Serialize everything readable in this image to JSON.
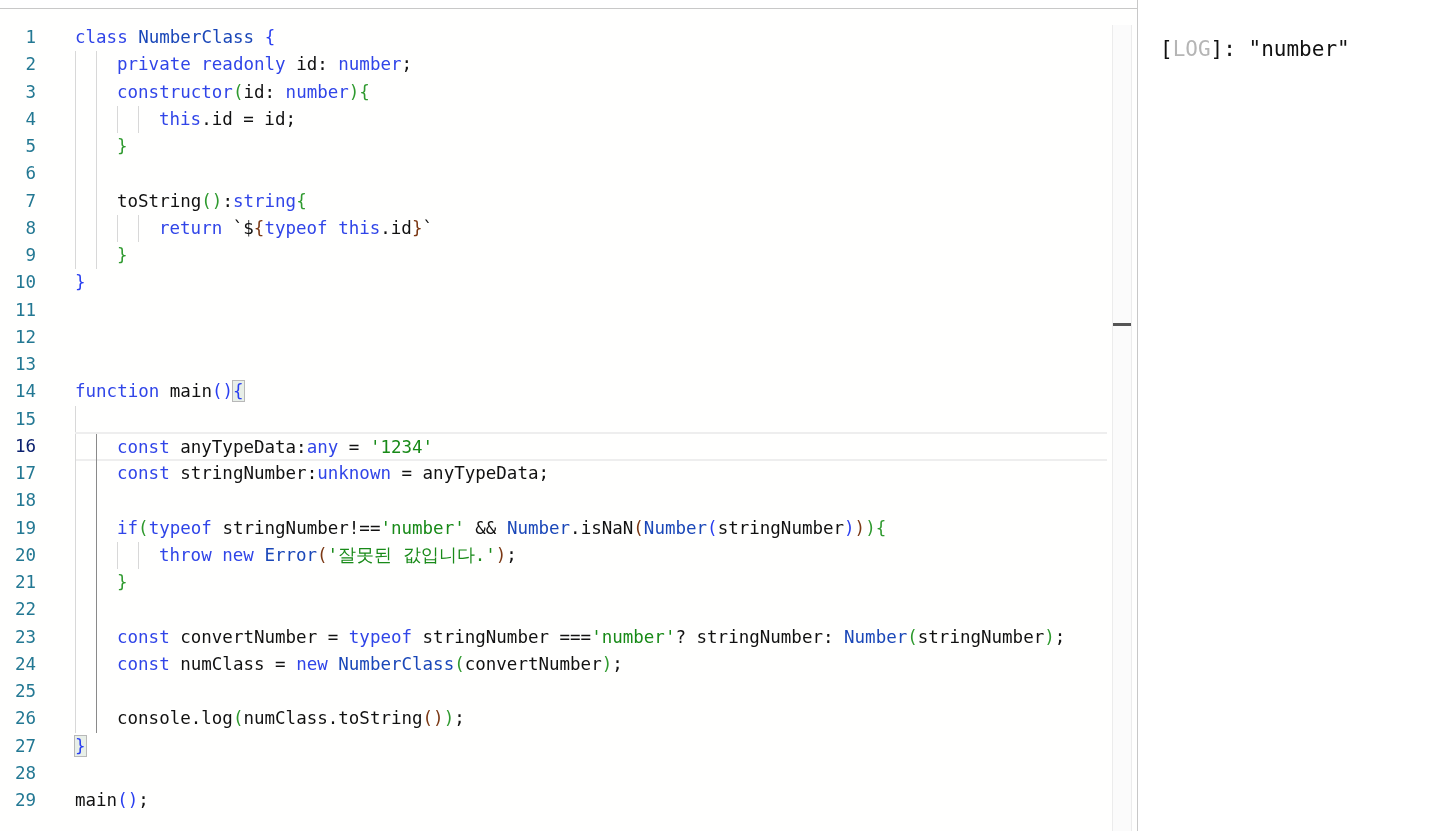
{
  "editor": {
    "lines": [
      {
        "number": "1",
        "current": false,
        "tokens": [
          {
            "kind": "kw",
            "text": "class"
          },
          {
            "kind": "cls",
            "text": " NumberClass"
          },
          {
            "kind": "b1",
            "text": " {"
          }
        ]
      },
      {
        "number": "2",
        "current": false,
        "guides": [
          {
            "active": false
          },
          {
            "active": false
          }
        ],
        "tokens": [
          {
            "kind": "kw",
            "text": "private"
          },
          {
            "kind": "kw",
            "text": " readonly"
          },
          {
            "kind": "plain",
            "text": " id: "
          },
          {
            "kind": "kw",
            "text": "number"
          },
          {
            "kind": "plain",
            "text": ";"
          }
        ]
      },
      {
        "number": "3",
        "current": false,
        "guides": [
          {
            "active": false
          },
          {
            "active": false
          }
        ],
        "tokens": [
          {
            "kind": "kw",
            "text": "constructor"
          },
          {
            "kind": "b2",
            "text": "("
          },
          {
            "kind": "plain",
            "text": "id: "
          },
          {
            "kind": "kw",
            "text": "number"
          },
          {
            "kind": "b2",
            "text": "){"
          }
        ]
      },
      {
        "number": "4",
        "current": false,
        "guides": [
          {
            "active": false
          },
          {
            "active": false
          },
          {
            "active": false
          },
          {
            "active": false
          }
        ],
        "tokens": [
          {
            "kind": "kw",
            "text": "this"
          },
          {
            "kind": "plain",
            "text": ".id = id;"
          }
        ]
      },
      {
        "number": "5",
        "current": false,
        "guides": [
          {
            "active": false
          },
          {
            "active": false
          }
        ],
        "tokens": [
          {
            "kind": "b2",
            "text": "}"
          }
        ]
      },
      {
        "number": "6",
        "current": false,
        "guides": [
          {
            "active": false
          },
          {
            "active": false
          }
        ]
      },
      {
        "number": "7",
        "current": false,
        "guides": [
          {
            "active": false
          },
          {
            "active": false
          }
        ],
        "tokens": [
          {
            "kind": "plain",
            "text": "toString"
          },
          {
            "kind": "b2",
            "text": "()"
          },
          {
            "kind": "plain",
            "text": ":"
          },
          {
            "kind": "kw",
            "text": "string"
          },
          {
            "kind": "b2",
            "text": "{"
          }
        ]
      },
      {
        "number": "8",
        "current": false,
        "guides": [
          {
            "active": false
          },
          {
            "active": false
          },
          {
            "active": false
          },
          {
            "active": false
          }
        ],
        "tokens": [
          {
            "kind": "kw",
            "text": "return"
          },
          {
            "kind": "plain",
            "text": " `$"
          },
          {
            "kind": "b3",
            "text": "{"
          },
          {
            "kind": "kw",
            "text": "typeof"
          },
          {
            "kind": "kw",
            "text": " this"
          },
          {
            "kind": "plain",
            "text": ".id"
          },
          {
            "kind": "b3",
            "text": "}"
          },
          {
            "kind": "plain",
            "text": "`"
          }
        ]
      },
      {
        "number": "9",
        "current": false,
        "guides": [
          {
            "active": false
          },
          {
            "active": false
          }
        ],
        "tokens": [
          {
            "kind": "b2",
            "text": "}"
          }
        ]
      },
      {
        "number": "10",
        "current": false,
        "tokens": [
          {
            "kind": "b1",
            "text": "}"
          }
        ]
      },
      {
        "number": "11",
        "current": false
      },
      {
        "number": "12",
        "current": false
      },
      {
        "number": "13",
        "current": false
      },
      {
        "number": "14",
        "current": false,
        "tokens": [
          {
            "kind": "kw",
            "text": "function"
          },
          {
            "kind": "plain",
            "text": " main"
          },
          {
            "kind": "b1",
            "text": "()"
          },
          {
            "kind": "match",
            "text": "{"
          }
        ]
      },
      {
        "number": "15",
        "current": false,
        "guides": [
          {
            "active": false
          }
        ]
      },
      {
        "number": "16",
        "current": true,
        "guides": [
          {
            "active": false
          },
          {
            "active": true
          }
        ],
        "tokens": [
          {
            "kind": "kw",
            "text": "const"
          },
          {
            "kind": "plain",
            "text": " anyTypeData:"
          },
          {
            "kind": "kw",
            "text": "any"
          },
          {
            "kind": "plain",
            "text": " = "
          },
          {
            "kind": "str",
            "text": "'1234'"
          }
        ]
      },
      {
        "number": "17",
        "current": false,
        "guides": [
          {
            "active": false
          },
          {
            "active": true
          }
        ],
        "tokens": [
          {
            "kind": "kw",
            "text": "const"
          },
          {
            "kind": "plain",
            "text": " stringNumber:"
          },
          {
            "kind": "kw",
            "text": "unknown"
          },
          {
            "kind": "plain",
            "text": " = anyTypeData;"
          }
        ]
      },
      {
        "number": "18",
        "current": false,
        "guides": [
          {
            "active": false
          },
          {
            "active": true
          }
        ]
      },
      {
        "number": "19",
        "current": false,
        "guides": [
          {
            "active": false
          },
          {
            "active": true
          }
        ],
        "tokens": [
          {
            "kind": "kw",
            "text": "if"
          },
          {
            "kind": "b2",
            "text": "("
          },
          {
            "kind": "kw",
            "text": "typeof"
          },
          {
            "kind": "plain",
            "text": " stringNumber!=="
          },
          {
            "kind": "str",
            "text": "'number'"
          },
          {
            "kind": "plain",
            "text": " && "
          },
          {
            "kind": "cls",
            "text": "Number"
          },
          {
            "kind": "plain",
            "text": ".isNaN"
          },
          {
            "kind": "b3",
            "text": "("
          },
          {
            "kind": "cls",
            "text": "Number"
          },
          {
            "kind": "b1",
            "text": "("
          },
          {
            "kind": "plain",
            "text": "stringNumber"
          },
          {
            "kind": "b1",
            "text": ")"
          },
          {
            "kind": "b3",
            "text": ")"
          },
          {
            "kind": "b2",
            "text": "){"
          }
        ]
      },
      {
        "number": "20",
        "current": false,
        "guides": [
          {
            "active": false
          },
          {
            "active": true
          },
          {
            "active": false
          },
          {
            "active": false
          }
        ],
        "tokens": [
          {
            "kind": "kw",
            "text": "throw"
          },
          {
            "kind": "kw",
            "text": " new"
          },
          {
            "kind": "cls",
            "text": " Error"
          },
          {
            "kind": "b3",
            "text": "("
          },
          {
            "kind": "str",
            "text": "'잘못된 값입니다.'"
          },
          {
            "kind": "b3",
            "text": ")"
          },
          {
            "kind": "plain",
            "text": ";"
          }
        ]
      },
      {
        "number": "21",
        "current": false,
        "guides": [
          {
            "active": false
          },
          {
            "active": true
          }
        ],
        "tokens": [
          {
            "kind": "b2",
            "text": "}"
          }
        ]
      },
      {
        "number": "22",
        "current": false,
        "guides": [
          {
            "active": false
          },
          {
            "active": true
          }
        ]
      },
      {
        "number": "23",
        "current": false,
        "guides": [
          {
            "active": false
          },
          {
            "active": true
          }
        ],
        "tokens": [
          {
            "kind": "kw",
            "text": "const"
          },
          {
            "kind": "plain",
            "text": " convertNumber = "
          },
          {
            "kind": "kw",
            "text": "typeof"
          },
          {
            "kind": "plain",
            "text": " stringNumber ==="
          },
          {
            "kind": "str",
            "text": "'number'"
          },
          {
            "kind": "plain",
            "text": "? stringNumber: "
          },
          {
            "kind": "cls",
            "text": "Number"
          },
          {
            "kind": "b2",
            "text": "("
          },
          {
            "kind": "plain",
            "text": "stringNumber"
          },
          {
            "kind": "b2",
            "text": ")"
          },
          {
            "kind": "plain",
            "text": ";"
          }
        ]
      },
      {
        "number": "24",
        "current": false,
        "guides": [
          {
            "active": false
          },
          {
            "active": true
          }
        ],
        "tokens": [
          {
            "kind": "kw",
            "text": "const"
          },
          {
            "kind": "plain",
            "text": " numClass = "
          },
          {
            "kind": "kw",
            "text": "new"
          },
          {
            "kind": "cls",
            "text": " NumberClass"
          },
          {
            "kind": "b2",
            "text": "("
          },
          {
            "kind": "plain",
            "text": "convertNumber"
          },
          {
            "kind": "b2",
            "text": ")"
          },
          {
            "kind": "plain",
            "text": ";"
          }
        ]
      },
      {
        "number": "25",
        "current": false,
        "guides": [
          {
            "active": false
          },
          {
            "active": true
          }
        ]
      },
      {
        "number": "26",
        "current": false,
        "guides": [
          {
            "active": false
          },
          {
            "active": true
          }
        ],
        "tokens": [
          {
            "kind": "plain",
            "text": "console.log"
          },
          {
            "kind": "b2",
            "text": "("
          },
          {
            "kind": "plain",
            "text": "numClass.toString"
          },
          {
            "kind": "b3",
            "text": "()"
          },
          {
            "kind": "b2",
            "text": ")"
          },
          {
            "kind": "plain",
            "text": ";"
          }
        ]
      },
      {
        "number": "27",
        "current": false,
        "tokens": [
          {
            "kind": "match",
            "text": "}"
          }
        ]
      },
      {
        "number": "28",
        "current": false
      },
      {
        "number": "29",
        "current": false,
        "tokens": [
          {
            "kind": "plain",
            "text": "main"
          },
          {
            "kind": "b1",
            "text": "()"
          },
          {
            "kind": "plain",
            "text": ";"
          }
        ]
      }
    ]
  },
  "console": {
    "entries": [
      {
        "open": "[",
        "level": "LOG",
        "rest": "]: \"number\""
      }
    ]
  }
}
